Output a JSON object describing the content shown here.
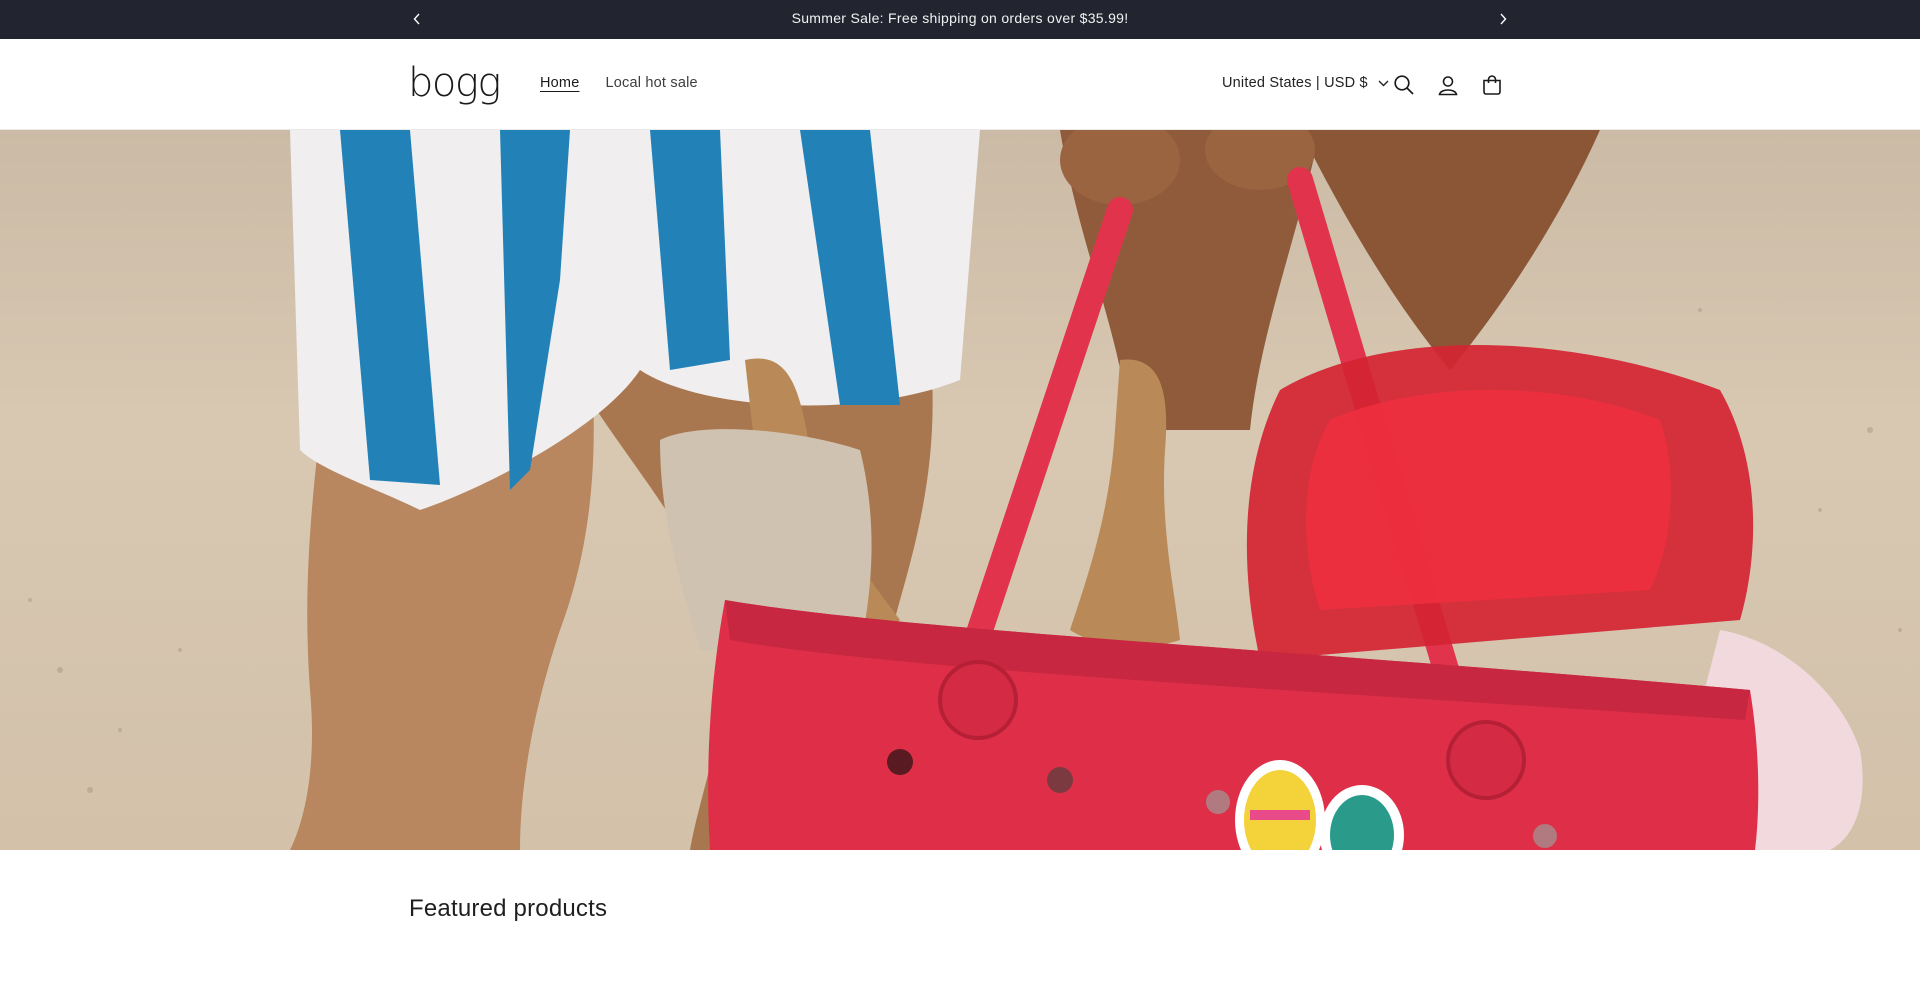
{
  "announcement": {
    "message": "Summer Sale: Free shipping on orders over $35.99!",
    "prev_icon": "chevron-left-icon",
    "next_icon": "chevron-right-icon"
  },
  "header": {
    "logo": "bogg",
    "nav": [
      {
        "label": "Home",
        "active": true
      },
      {
        "label": "Local hot sale",
        "active": false
      }
    ],
    "locale": "United States | USD $",
    "icons": [
      "search-icon",
      "account-icon",
      "cart-icon"
    ]
  },
  "hero": {
    "description_icon": "hero-banner-image"
  },
  "featured": {
    "title": "Featured products"
  },
  "colors": {
    "announcement_bg": "#222530",
    "bag_red": "#e03048",
    "sand": "#d6c5ae"
  }
}
